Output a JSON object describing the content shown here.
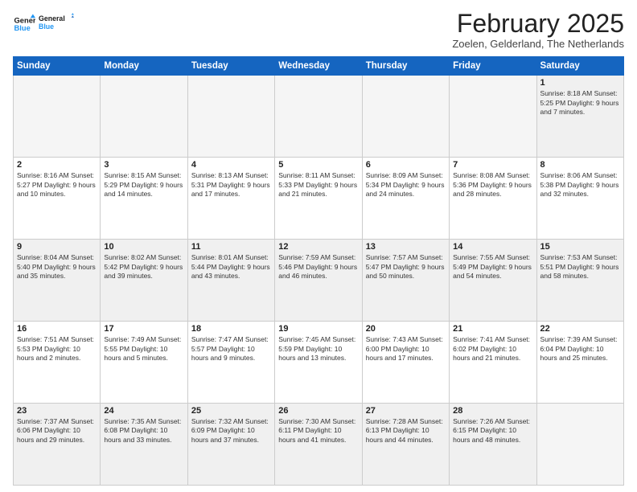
{
  "logo": {
    "line1": "General",
    "line2": "Blue"
  },
  "title": "February 2025",
  "location": "Zoelen, Gelderland, The Netherlands",
  "days_of_week": [
    "Sunday",
    "Monday",
    "Tuesday",
    "Wednesday",
    "Thursday",
    "Friday",
    "Saturday"
  ],
  "weeks": [
    [
      {
        "day": "",
        "info": ""
      },
      {
        "day": "",
        "info": ""
      },
      {
        "day": "",
        "info": ""
      },
      {
        "day": "",
        "info": ""
      },
      {
        "day": "",
        "info": ""
      },
      {
        "day": "",
        "info": ""
      },
      {
        "day": "1",
        "info": "Sunrise: 8:18 AM\nSunset: 5:25 PM\nDaylight: 9 hours and 7 minutes."
      }
    ],
    [
      {
        "day": "2",
        "info": "Sunrise: 8:16 AM\nSunset: 5:27 PM\nDaylight: 9 hours and 10 minutes."
      },
      {
        "day": "3",
        "info": "Sunrise: 8:15 AM\nSunset: 5:29 PM\nDaylight: 9 hours and 14 minutes."
      },
      {
        "day": "4",
        "info": "Sunrise: 8:13 AM\nSunset: 5:31 PM\nDaylight: 9 hours and 17 minutes."
      },
      {
        "day": "5",
        "info": "Sunrise: 8:11 AM\nSunset: 5:33 PM\nDaylight: 9 hours and 21 minutes."
      },
      {
        "day": "6",
        "info": "Sunrise: 8:09 AM\nSunset: 5:34 PM\nDaylight: 9 hours and 24 minutes."
      },
      {
        "day": "7",
        "info": "Sunrise: 8:08 AM\nSunset: 5:36 PM\nDaylight: 9 hours and 28 minutes."
      },
      {
        "day": "8",
        "info": "Sunrise: 8:06 AM\nSunset: 5:38 PM\nDaylight: 9 hours and 32 minutes."
      }
    ],
    [
      {
        "day": "9",
        "info": "Sunrise: 8:04 AM\nSunset: 5:40 PM\nDaylight: 9 hours and 35 minutes."
      },
      {
        "day": "10",
        "info": "Sunrise: 8:02 AM\nSunset: 5:42 PM\nDaylight: 9 hours and 39 minutes."
      },
      {
        "day": "11",
        "info": "Sunrise: 8:01 AM\nSunset: 5:44 PM\nDaylight: 9 hours and 43 minutes."
      },
      {
        "day": "12",
        "info": "Sunrise: 7:59 AM\nSunset: 5:46 PM\nDaylight: 9 hours and 46 minutes."
      },
      {
        "day": "13",
        "info": "Sunrise: 7:57 AM\nSunset: 5:47 PM\nDaylight: 9 hours and 50 minutes."
      },
      {
        "day": "14",
        "info": "Sunrise: 7:55 AM\nSunset: 5:49 PM\nDaylight: 9 hours and 54 minutes."
      },
      {
        "day": "15",
        "info": "Sunrise: 7:53 AM\nSunset: 5:51 PM\nDaylight: 9 hours and 58 minutes."
      }
    ],
    [
      {
        "day": "16",
        "info": "Sunrise: 7:51 AM\nSunset: 5:53 PM\nDaylight: 10 hours and 2 minutes."
      },
      {
        "day": "17",
        "info": "Sunrise: 7:49 AM\nSunset: 5:55 PM\nDaylight: 10 hours and 5 minutes."
      },
      {
        "day": "18",
        "info": "Sunrise: 7:47 AM\nSunset: 5:57 PM\nDaylight: 10 hours and 9 minutes."
      },
      {
        "day": "19",
        "info": "Sunrise: 7:45 AM\nSunset: 5:59 PM\nDaylight: 10 hours and 13 minutes."
      },
      {
        "day": "20",
        "info": "Sunrise: 7:43 AM\nSunset: 6:00 PM\nDaylight: 10 hours and 17 minutes."
      },
      {
        "day": "21",
        "info": "Sunrise: 7:41 AM\nSunset: 6:02 PM\nDaylight: 10 hours and 21 minutes."
      },
      {
        "day": "22",
        "info": "Sunrise: 7:39 AM\nSunset: 6:04 PM\nDaylight: 10 hours and 25 minutes."
      }
    ],
    [
      {
        "day": "23",
        "info": "Sunrise: 7:37 AM\nSunset: 6:06 PM\nDaylight: 10 hours and 29 minutes."
      },
      {
        "day": "24",
        "info": "Sunrise: 7:35 AM\nSunset: 6:08 PM\nDaylight: 10 hours and 33 minutes."
      },
      {
        "day": "25",
        "info": "Sunrise: 7:32 AM\nSunset: 6:09 PM\nDaylight: 10 hours and 37 minutes."
      },
      {
        "day": "26",
        "info": "Sunrise: 7:30 AM\nSunset: 6:11 PM\nDaylight: 10 hours and 41 minutes."
      },
      {
        "day": "27",
        "info": "Sunrise: 7:28 AM\nSunset: 6:13 PM\nDaylight: 10 hours and 44 minutes."
      },
      {
        "day": "28",
        "info": "Sunrise: 7:26 AM\nSunset: 6:15 PM\nDaylight: 10 hours and 48 minutes."
      },
      {
        "day": "",
        "info": ""
      }
    ]
  ]
}
